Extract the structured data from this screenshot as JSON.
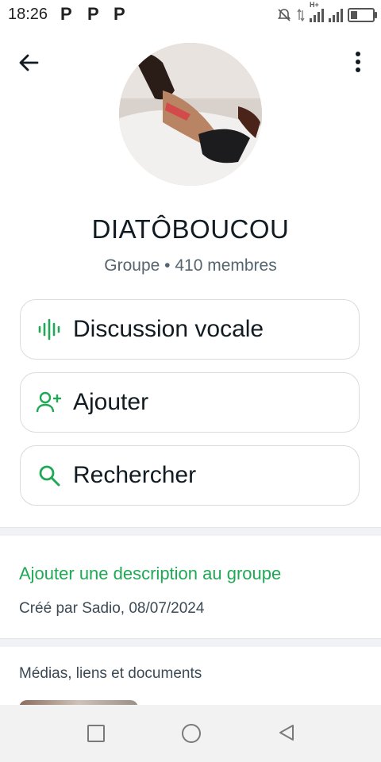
{
  "status_bar": {
    "time": "18:26",
    "notification_icons": [
      "P",
      "P",
      "P"
    ],
    "network_label": "H+"
  },
  "group": {
    "name": "DIATÔBOUCOU",
    "meta": "Groupe • 410 membres"
  },
  "actions": [
    {
      "label": "Discussion vocale",
      "icon": "voice-waveform-icon"
    },
    {
      "label": "Ajouter",
      "icon": "add-person-icon"
    },
    {
      "label": "Rechercher",
      "icon": "search-icon"
    }
  ],
  "description": {
    "add_link": "Ajouter une description au groupe",
    "created_by": "Créé par Sadio, 08/07/2024"
  },
  "media": {
    "title": "Médias, liens et documents"
  },
  "colors": {
    "accent": "#1fa855",
    "text_primary": "#111b21",
    "text_secondary": "#54656f"
  }
}
